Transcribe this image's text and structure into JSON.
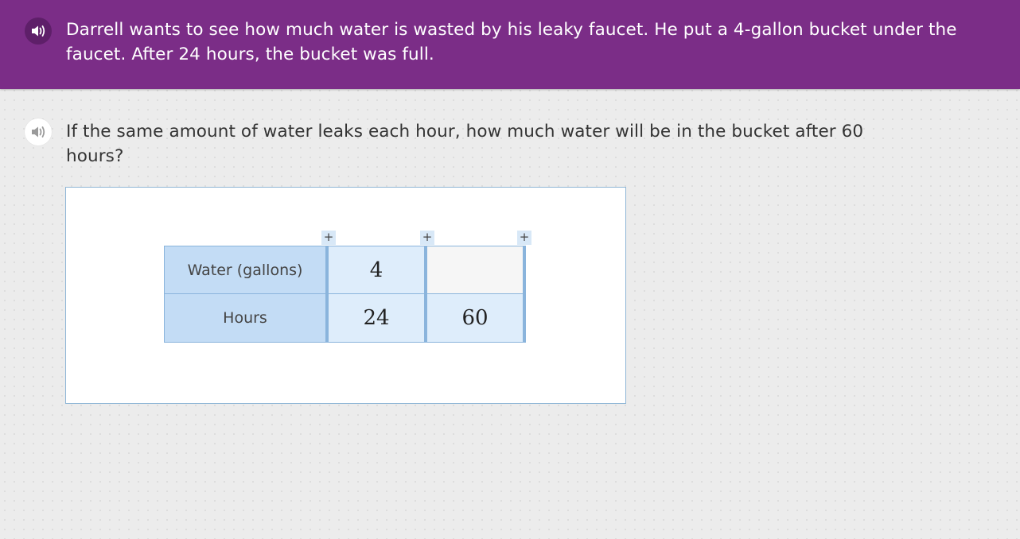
{
  "colors": {
    "banner_background": "#7b2d87",
    "page_background": "#ececec",
    "table_header": "#c3dcf5",
    "table_cell": "#deedfb",
    "table_border": "#8ab4dc"
  },
  "context": {
    "audio_icon": "speaker-icon",
    "text": "Darrell wants to see how much water is wasted by his leaky faucet. He put a 4-gallon bucket under the faucet. After 24 hours, the bucket was full."
  },
  "question": {
    "audio_icon": "speaker-icon",
    "text": "If the same amount of water leaks each hour, how much water will be in the bucket after 60 hours?"
  },
  "ratio_table": {
    "add_column_symbol": "+",
    "rows": [
      {
        "label": "Water (gallons)",
        "values": [
          "4",
          ""
        ]
      },
      {
        "label": "Hours",
        "values": [
          "24",
          "60"
        ]
      }
    ]
  }
}
